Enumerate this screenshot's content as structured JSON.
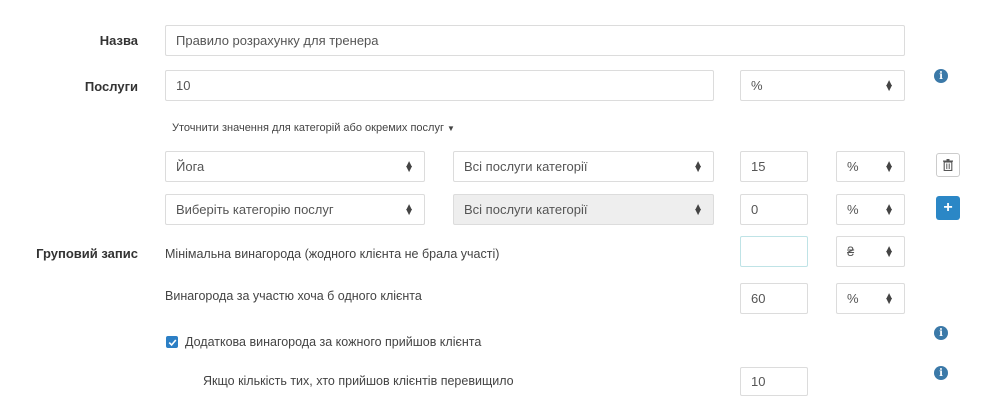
{
  "form": {
    "name_label": "Назва",
    "name_value": "Правило розрахунку для тренера",
    "services_label": "Послуги",
    "services_value": "10",
    "services_unit": "%",
    "refine_link": "Уточнити значення для категорій або окремих послуг",
    "category_rows": [
      {
        "category": "Йога",
        "service": "Всі послуги категорії",
        "amount": "15",
        "unit": "%"
      },
      {
        "category": "Виберіть категорію послуг",
        "service": "Всі послуги категорії",
        "amount": "0",
        "unit": "%"
      }
    ],
    "group_label": "Груповий запис",
    "min_reward_label": "Мінімальна винагорода (жодного клієнта не брала участі)",
    "min_reward_value": "",
    "min_reward_unit": "₴",
    "one_client_label": "Винагорода за участю хоча б одного клієнта",
    "one_client_value": "60",
    "one_client_unit": "%",
    "extra_checkbox_label": "Додаткова винагорода за кожного прийшов клієнта",
    "extra_checked": true,
    "threshold_label": "Якщо кількість тих, хто прийшов клієнтів перевищило",
    "threshold_value": "10"
  },
  "icons": {
    "info": "info-icon",
    "trash": "trash-icon",
    "add": "plus-icon",
    "caret": "select-caret-icon"
  }
}
